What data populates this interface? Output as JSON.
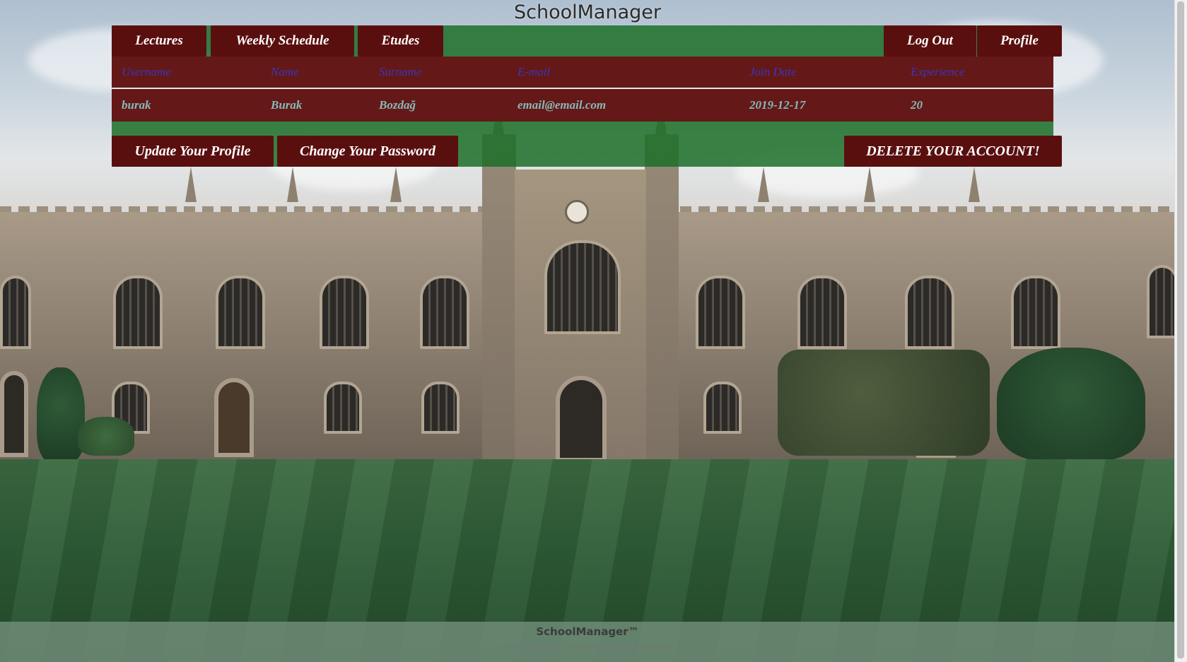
{
  "header": {
    "title": "SchoolManager"
  },
  "nav": {
    "lectures": "Lectures",
    "weekly_schedule": "Weekly Schedule",
    "etudes": "Etudes",
    "log_out": "Log Out",
    "profile": "Profile"
  },
  "profile_table": {
    "headers": [
      "Username",
      "Name",
      "Surname",
      "E-mail",
      "Join Date",
      "Experience"
    ],
    "row": [
      "burak",
      "Burak",
      "Bozdağ",
      "email@email.com",
      "2019-12-17",
      "20"
    ]
  },
  "actions": {
    "update_profile": "Update Your Profile",
    "change_password": "Change Your Password",
    "delete_account": "DELETE YOUR ACCOUNT!"
  },
  "footer": {
    "brand": "SchoolManager™",
    "copyright": "© 2019-2020, burocknroll & furblood"
  },
  "colors": {
    "button_bg": "#5a0f0f",
    "bar_green": "#1c6e28",
    "table_bg": "#651818",
    "header_text": "#3a36b8",
    "data_text": "#86b9b6"
  }
}
